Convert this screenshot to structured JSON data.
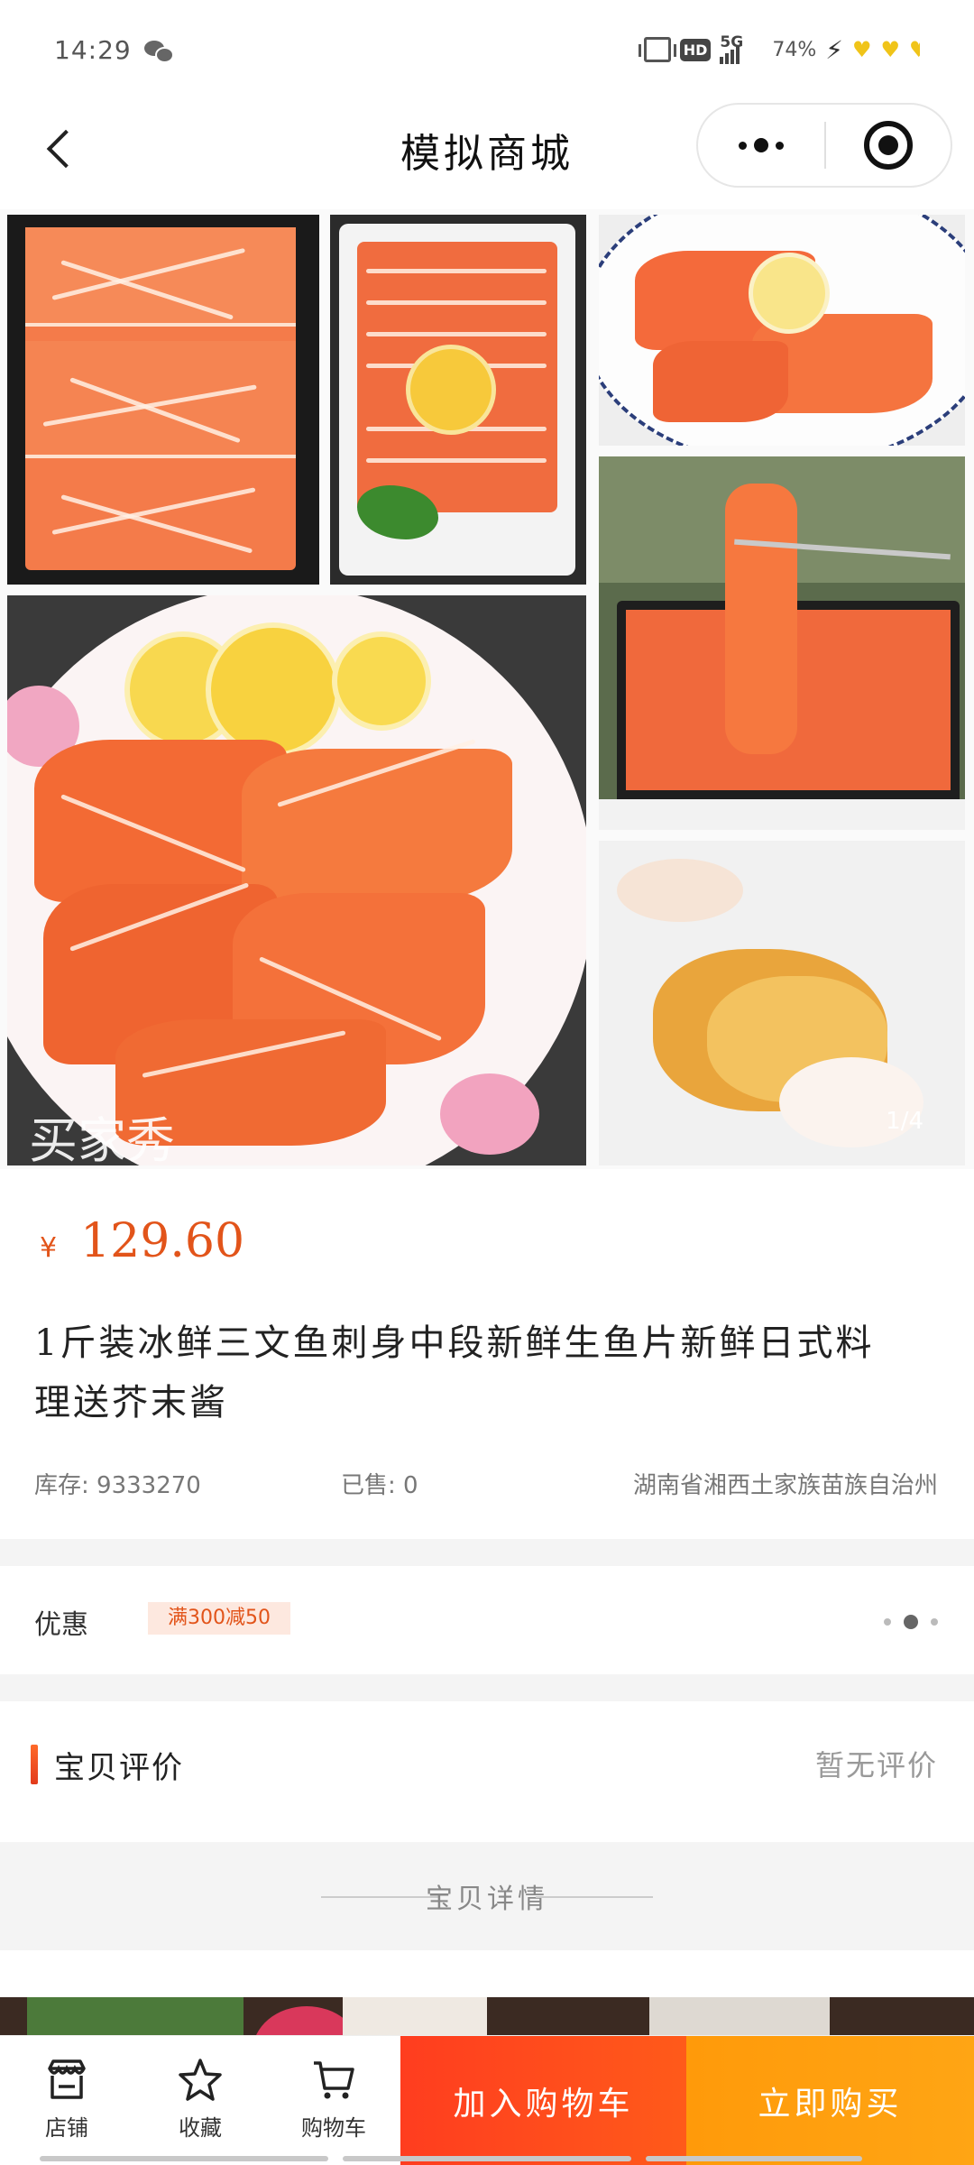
{
  "status_bar": {
    "time": "14:29",
    "network": "5G",
    "hd": "HD",
    "battery": "74%"
  },
  "header": {
    "title": "模拟商城"
  },
  "gallery": {
    "counter": "1/4",
    "watermark": "买家秀"
  },
  "product": {
    "currency": "¥",
    "price": "129.60",
    "title": "1斤装冰鲜三文鱼刺身中段新鲜生鱼片新鲜日式料理送芥末酱",
    "stock": "库存: 9333270",
    "sold": "已售: 0",
    "location": "湖南省湘西土家族苗族自治州"
  },
  "promo": {
    "label": "优惠",
    "tag": "满300减50"
  },
  "reviews": {
    "title": "宝贝评价",
    "empty": "暂无评价"
  },
  "details": {
    "title": "宝贝详情"
  },
  "bottom_bar": {
    "tabs": [
      {
        "label": "店铺",
        "icon": "store-icon"
      },
      {
        "label": "收藏",
        "icon": "star-icon"
      },
      {
        "label": "购物车",
        "icon": "cart-icon"
      }
    ],
    "add_to_cart": "加入购物车",
    "buy_now": "立即购买"
  },
  "colors": {
    "accent": "#e2541a",
    "cart_button": "#ff3d1f",
    "buy_button": "#ffa514"
  }
}
